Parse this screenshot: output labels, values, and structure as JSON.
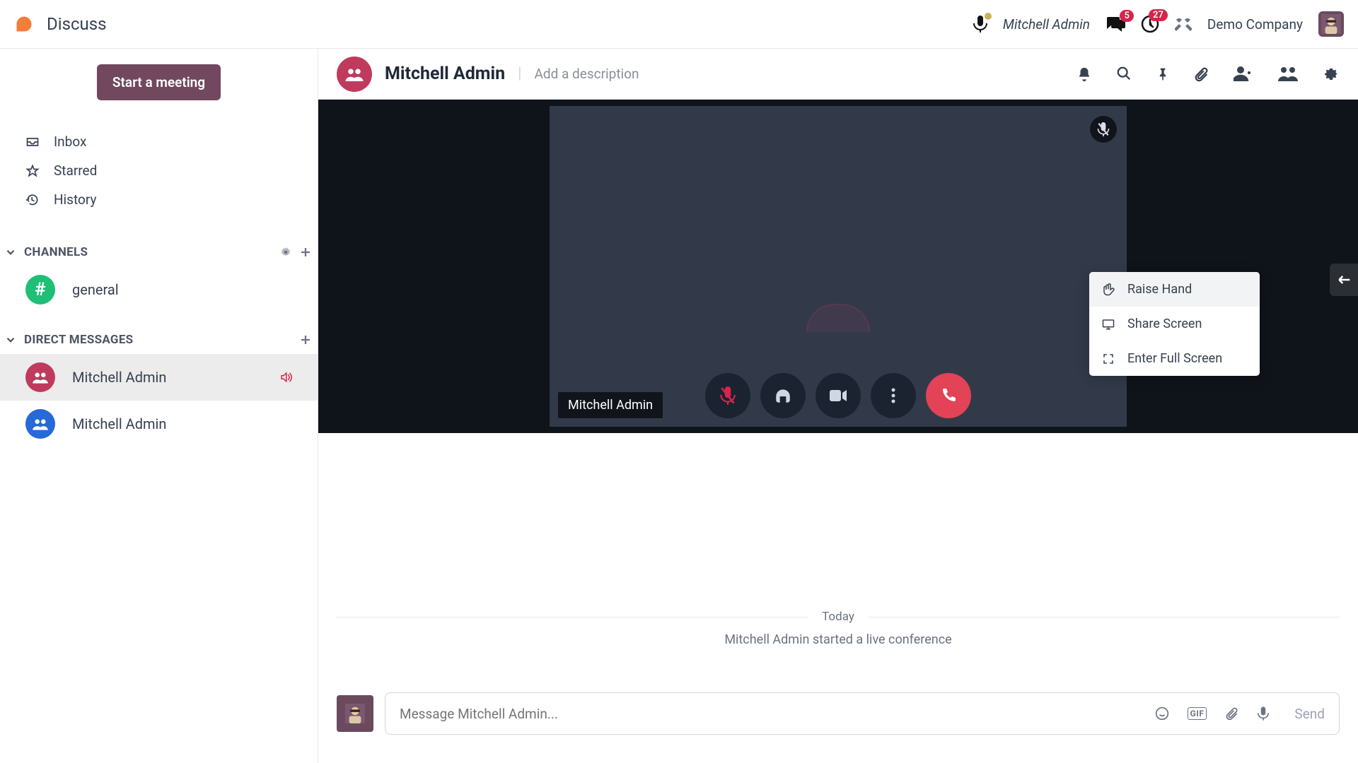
{
  "app": {
    "title": "Discuss"
  },
  "topbar": {
    "username": "Mitchell Admin",
    "company": "Demo Company",
    "messages_badge": "5",
    "activities_badge": "27"
  },
  "sidebar": {
    "start_meeting": "Start a meeting",
    "inbox": "Inbox",
    "starred": "Starred",
    "history": "History",
    "channels_label": "CHANNELS",
    "channels": [
      {
        "name": "general"
      }
    ],
    "dm_label": "DIRECT MESSAGES",
    "dms": [
      {
        "name": "Mitchell Admin",
        "active": true,
        "color": "red",
        "audio": true
      },
      {
        "name": "Mitchell Admin",
        "active": false,
        "color": "blue",
        "audio": false
      }
    ]
  },
  "chat": {
    "title": "Mitchell Admin",
    "description_placeholder": "Add a description",
    "video_name": "Mitchell Admin",
    "ctx": {
      "raise_hand": "Raise Hand",
      "share_screen": "Share Screen",
      "full_screen": "Enter Full Screen"
    },
    "day": "Today",
    "system_msg": "Mitchell Admin started a live conference"
  },
  "composer": {
    "placeholder": "Message Mitchell Admin...",
    "gif": "GIF",
    "send": "Send"
  }
}
